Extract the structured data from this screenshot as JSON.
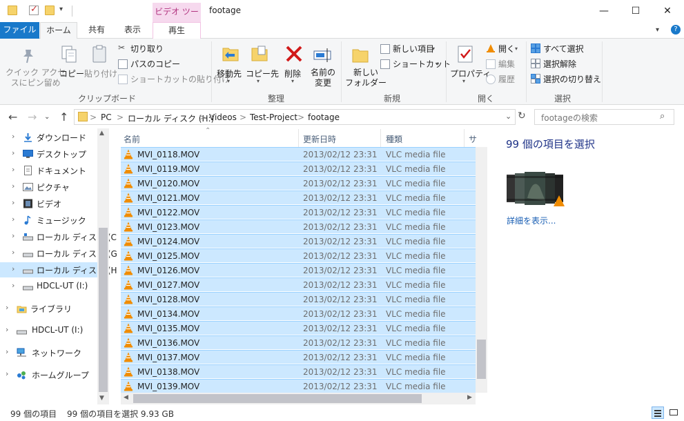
{
  "window": {
    "title": "footage",
    "context_tab": "ビデオ ツール",
    "controls": {
      "minimize": "—",
      "maximize": "☐",
      "close": "✕"
    }
  },
  "tabs": {
    "file": "ファイル",
    "home": "ホーム",
    "share": "共有",
    "view": "表示",
    "play": "再生",
    "help": "?"
  },
  "ribbon": {
    "clipboard": {
      "pin": "クイック アクセ\nスにピン留め",
      "copy": "コピー",
      "paste": "貼り付け",
      "cut": "切り取り",
      "copy_path": "パスのコピー",
      "paste_shortcut": "ショートカットの貼り付け",
      "label": "クリップボード"
    },
    "organize": {
      "move_to": "移動先",
      "copy_to": "コピー先",
      "delete": "削除",
      "rename": "名前の\n変更",
      "label": "整理"
    },
    "new": {
      "new_folder": "新しい\nフォルダー",
      "new_item": "新しい項目",
      "shortcut": "ショートカット",
      "label": "新規"
    },
    "open": {
      "properties": "プロパティ",
      "open": "開く",
      "edit": "編集",
      "history": "履歴",
      "label": "開く"
    },
    "select": {
      "select_all": "すべて選択",
      "select_none": "選択解除",
      "invert": "選択の切り替え",
      "label": "選択"
    }
  },
  "address": {
    "crumbs": [
      "PC",
      "ローカル ディスク (H:)",
      "Videos",
      "Test-Project",
      "footage"
    ],
    "separator": ">",
    "search_placeholder": "footageの検索"
  },
  "nav": {
    "items": [
      {
        "label": "ダウンロード",
        "icon": "download-icon"
      },
      {
        "label": "デスクトップ",
        "icon": "desktop-icon"
      },
      {
        "label": "ドキュメント",
        "icon": "document-icon"
      },
      {
        "label": "ピクチャ",
        "icon": "picture-icon"
      },
      {
        "label": "ビデオ",
        "icon": "video-icon"
      },
      {
        "label": "ミュージック",
        "icon": "music-icon"
      },
      {
        "label": "ローカル ディスク (C",
        "icon": "drive-icon"
      },
      {
        "label": "ローカル ディスク (G",
        "icon": "drive-icon"
      },
      {
        "label": "ローカル ディスク (H",
        "icon": "drive-icon",
        "selected": true
      },
      {
        "label": "HDCL-UT (I:)",
        "icon": "drive-icon"
      },
      {
        "label": "ライブラリ",
        "icon": "library-icon"
      },
      {
        "label": "HDCL-UT (I:)",
        "icon": "drive-icon"
      },
      {
        "label": "ネットワーク",
        "icon": "network-icon"
      },
      {
        "label": "ホームグループ",
        "icon": "homegroup-icon"
      }
    ]
  },
  "filelist": {
    "columns": {
      "name": "名前",
      "date": "更新日時",
      "type": "種類",
      "size": "サ"
    },
    "rows": [
      {
        "name": "MVI_0118.MOV",
        "date": "2013/02/12 23:31",
        "type": "VLC media file"
      },
      {
        "name": "MVI_0119.MOV",
        "date": "2013/02/12 23:31",
        "type": "VLC media file"
      },
      {
        "name": "MVI_0120.MOV",
        "date": "2013/02/12 23:31",
        "type": "VLC media file"
      },
      {
        "name": "MVI_0121.MOV",
        "date": "2013/02/12 23:31",
        "type": "VLC media file"
      },
      {
        "name": "MVI_0122.MOV",
        "date": "2013/02/12 23:31",
        "type": "VLC media file"
      },
      {
        "name": "MVI_0123.MOV",
        "date": "2013/02/12 23:31",
        "type": "VLC media file"
      },
      {
        "name": "MVI_0124.MOV",
        "date": "2013/02/12 23:31",
        "type": "VLC media file"
      },
      {
        "name": "MVI_0125.MOV",
        "date": "2013/02/12 23:31",
        "type": "VLC media file"
      },
      {
        "name": "MVI_0126.MOV",
        "date": "2013/02/12 23:31",
        "type": "VLC media file"
      },
      {
        "name": "MVI_0127.MOV",
        "date": "2013/02/12 23:31",
        "type": "VLC media file"
      },
      {
        "name": "MVI_0128.MOV",
        "date": "2013/02/12 23:31",
        "type": "VLC media file"
      },
      {
        "name": "MVI_0134.MOV",
        "date": "2013/02/12 23:31",
        "type": "VLC media file"
      },
      {
        "name": "MVI_0135.MOV",
        "date": "2013/02/12 23:31",
        "type": "VLC media file"
      },
      {
        "name": "MVI_0136.MOV",
        "date": "2013/02/12 23:31",
        "type": "VLC media file"
      },
      {
        "name": "MVI_0137.MOV",
        "date": "2013/02/12 23:31",
        "type": "VLC media file"
      },
      {
        "name": "MVI_0138.MOV",
        "date": "2013/02/12 23:31",
        "type": "VLC media file"
      },
      {
        "name": "MVI_0139.MOV",
        "date": "2013/02/12 23:31",
        "type": "VLC media file"
      }
    ]
  },
  "details": {
    "title": "99 個の項目を選択",
    "show_details": "詳細を表示..."
  },
  "status": {
    "count": "99 個の項目",
    "selected": "99 個の項目を選択  9.93 GB"
  },
  "colors": {
    "accent": "#1979ca",
    "selection": "#cce8ff",
    "selection_border": "#99d1ff",
    "vlc_orange": "#f08c00",
    "context_pink": "#f6d9ee"
  }
}
